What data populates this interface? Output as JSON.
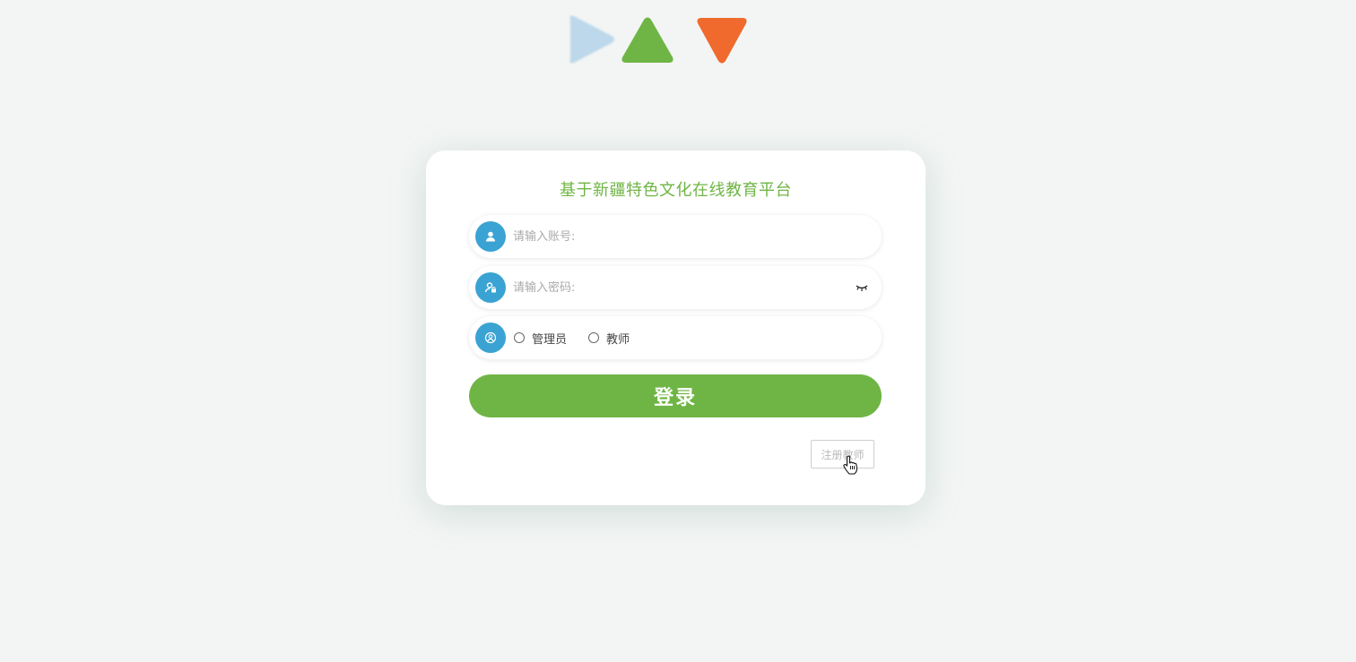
{
  "login": {
    "title": "基于新疆特色文化在线教育平台",
    "account_placeholder": "请输入账号:",
    "password_placeholder": "请输入密码:",
    "roles": [
      {
        "label": "管理员"
      },
      {
        "label": "教师"
      }
    ],
    "login_label": "登录",
    "register_label": "注册教师"
  },
  "icons": {
    "account": "user-icon",
    "password": "user-lock-icon",
    "role": "user-circle-icon",
    "toggle_password": "eye-closed-icon"
  },
  "colors": {
    "accent_green": "#6fb545",
    "icon_blue": "#3aa3d3",
    "shape_light_blue": "#bcd8ea",
    "shape_orange": "#ef6a2c"
  }
}
